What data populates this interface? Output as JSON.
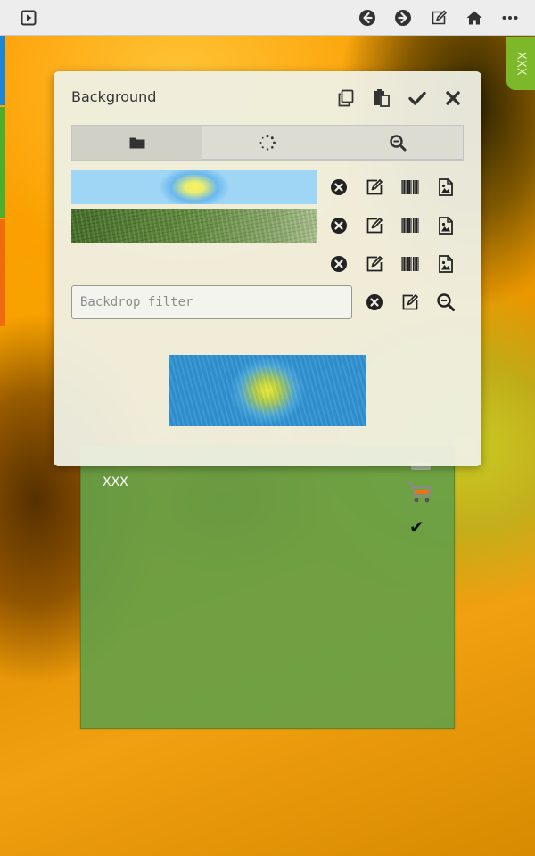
{
  "topbar": {
    "left_icon": "play-square-icon",
    "right_icons": [
      "arrow-left-circle-icon",
      "arrow-right-circle-icon",
      "edit-icon",
      "home-icon",
      "more-horizontal-icon"
    ]
  },
  "side_tab": {
    "label": "XXX"
  },
  "card": {
    "title": "XXX",
    "icons": [
      "cart-icon",
      "checkmark-icon"
    ],
    "color": "#66a046"
  },
  "dialog": {
    "title": "Background",
    "actions": [
      "copy-icon",
      "paste-icon",
      "check-icon",
      "close-icon"
    ],
    "tabs": [
      {
        "icon": "folder-icon",
        "active": true
      },
      {
        "icon": "spinner-icon",
        "active": false
      },
      {
        "icon": "zoom-out-icon",
        "active": false
      }
    ],
    "rows": [
      {
        "swatch": "gradient-blue-yellow",
        "icons": [
          "remove-icon",
          "edit-icon",
          "barcode-icon",
          "image-icon"
        ]
      },
      {
        "swatch": "texture-green",
        "icons": [
          "remove-icon",
          "edit-icon",
          "barcode-icon",
          "image-icon"
        ]
      },
      {
        "swatch": "none",
        "icons": [
          "remove-icon",
          "edit-icon",
          "barcode-icon",
          "image-icon"
        ]
      }
    ],
    "filter": {
      "placeholder": "Backdrop filter",
      "value": "",
      "icons": [
        "remove-icon",
        "edit-icon",
        "zoom-out-icon"
      ]
    }
  },
  "colors": {
    "edge_blue": "#1a86d8",
    "edge_green": "#4cae2c",
    "edge_orange": "#f26a10",
    "side_tab": "#7cb82a",
    "dialog_bg": "#eff0e4"
  }
}
